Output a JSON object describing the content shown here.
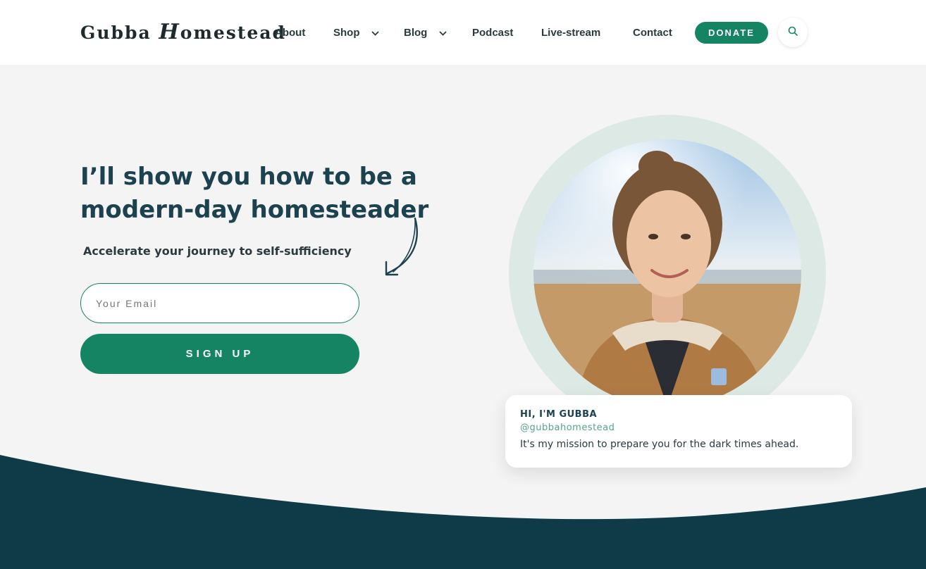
{
  "header": {
    "logo": {
      "word1": "Gubba",
      "word2_initial": "H",
      "word2_rest": "omestead"
    },
    "nav": [
      {
        "label": "About",
        "has_dropdown": false
      },
      {
        "label": "Shop",
        "has_dropdown": true
      },
      {
        "label": "Blog",
        "has_dropdown": true
      },
      {
        "label": "Podcast",
        "has_dropdown": false
      },
      {
        "label": "Live-stream",
        "has_dropdown": false
      },
      {
        "label": "Contact",
        "has_dropdown": false
      }
    ],
    "donate_label": "DONATE",
    "search_icon": "search-icon"
  },
  "hero": {
    "headline": "I’ll show you how to be a modern-day homesteader",
    "subheadline": "Accelerate your journey to self-sufficiency",
    "email_placeholder": "Your Email",
    "signup_label": "SIGN UP"
  },
  "profile_card": {
    "title": "HI, I'M GUBBA",
    "handle": "@gubbahomestead",
    "text": "It's my mission to prepare you for the dark times ahead."
  },
  "colors": {
    "accent_green": "#148463",
    "heading_teal": "#1c4250",
    "dark_wave": "#0e3b47",
    "ring": "#dde9e5",
    "background": "#f4f4f4"
  }
}
